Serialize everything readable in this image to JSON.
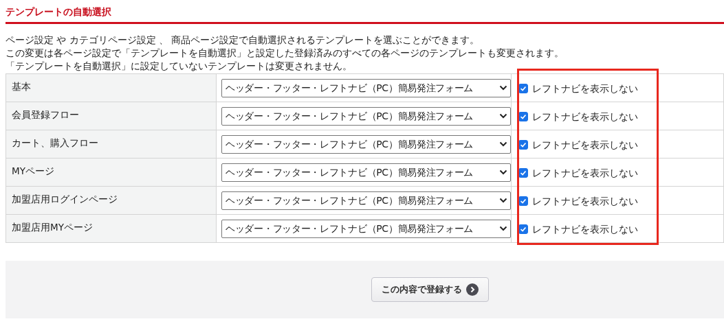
{
  "section_title": "テンプレートの自動選択",
  "description": [
    "ページ設定 や カテゴリページ設定 、 商品ページ設定で自動選択されるテンプレートを選ぶことができます。",
    "この変更は各ページ設定で「テンプレートを自動選択」と設定した登録済みのすべての各ページのテンプレートも変更されます。",
    "「テンプレートを自動選択」に設定していないテンプレートは変更されません。"
  ],
  "rows": [
    {
      "label": "基本",
      "template": "ヘッダー・フッター・レフトナビ（PC）簡易発注フォーム",
      "option": "レフトナビを表示しない",
      "checked": true
    },
    {
      "label": "会員登録フロー",
      "template": "ヘッダー・フッター・レフトナビ（PC）簡易発注フォーム",
      "option": "レフトナビを表示しない",
      "checked": true
    },
    {
      "label": "カート、購入フロー",
      "template": "ヘッダー・フッター・レフトナビ（PC）簡易発注フォーム",
      "option": "レフトナビを表示しない",
      "checked": true
    },
    {
      "label": "MYページ",
      "template": "ヘッダー・フッター・レフトナビ（PC）簡易発注フォーム",
      "option": "レフトナビを表示しない",
      "checked": true
    },
    {
      "label": "加盟店用ログインページ",
      "template": "ヘッダー・フッター・レフトナビ（PC）簡易発注フォーム",
      "option": "レフトナビを表示しない",
      "checked": true
    },
    {
      "label": "加盟店用MYページ",
      "template": "ヘッダー・フッター・レフトナビ（PC）簡易発注フォーム",
      "option": "レフトナビを表示しない",
      "checked": true
    }
  ],
  "highlight": {
    "color": "#e8281e"
  },
  "submit_button": "この内容で登録する"
}
